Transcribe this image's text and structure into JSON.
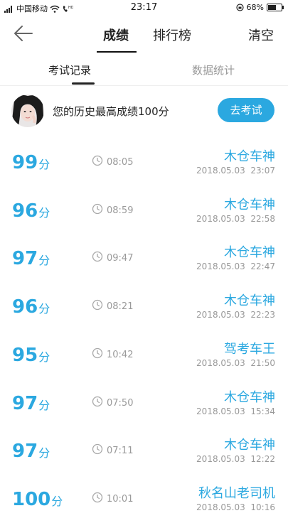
{
  "status_bar": {
    "carrier": "中国移动",
    "time": "23:17",
    "battery": "68%",
    "battery_level": 0.68
  },
  "nav": {
    "tab_scores": "成绩",
    "tab_ranking": "排行榜",
    "clear": "清空"
  },
  "sub_tabs": {
    "records": "考试记录",
    "stats": "数据统计"
  },
  "best": {
    "text": "您的历史最高成绩100分",
    "button": "去考试"
  },
  "score_unit": "分",
  "records": [
    {
      "score": "99",
      "duration": "08:05",
      "name": "木仓车神",
      "date": "2018.05.03",
      "time": "23:07"
    },
    {
      "score": "96",
      "duration": "08:59",
      "name": "木仓车神",
      "date": "2018.05.03",
      "time": "22:58"
    },
    {
      "score": "97",
      "duration": "09:47",
      "name": "木仓车神",
      "date": "2018.05.03",
      "time": "22:47"
    },
    {
      "score": "96",
      "duration": "08:21",
      "name": "木仓车神",
      "date": "2018.05.03",
      "time": "22:23"
    },
    {
      "score": "95",
      "duration": "10:42",
      "name": "驾考车王",
      "date": "2018.05.03",
      "time": "21:50"
    },
    {
      "score": "97",
      "duration": "07:50",
      "name": "木仓车神",
      "date": "2018.05.03",
      "time": "15:34"
    },
    {
      "score": "97",
      "duration": "07:11",
      "name": "木仓车神",
      "date": "2018.05.03",
      "time": "12:22"
    },
    {
      "score": "100",
      "duration": "10:01",
      "name": "秋名山老司机",
      "date": "2018.05.03",
      "time": "10:16"
    }
  ]
}
